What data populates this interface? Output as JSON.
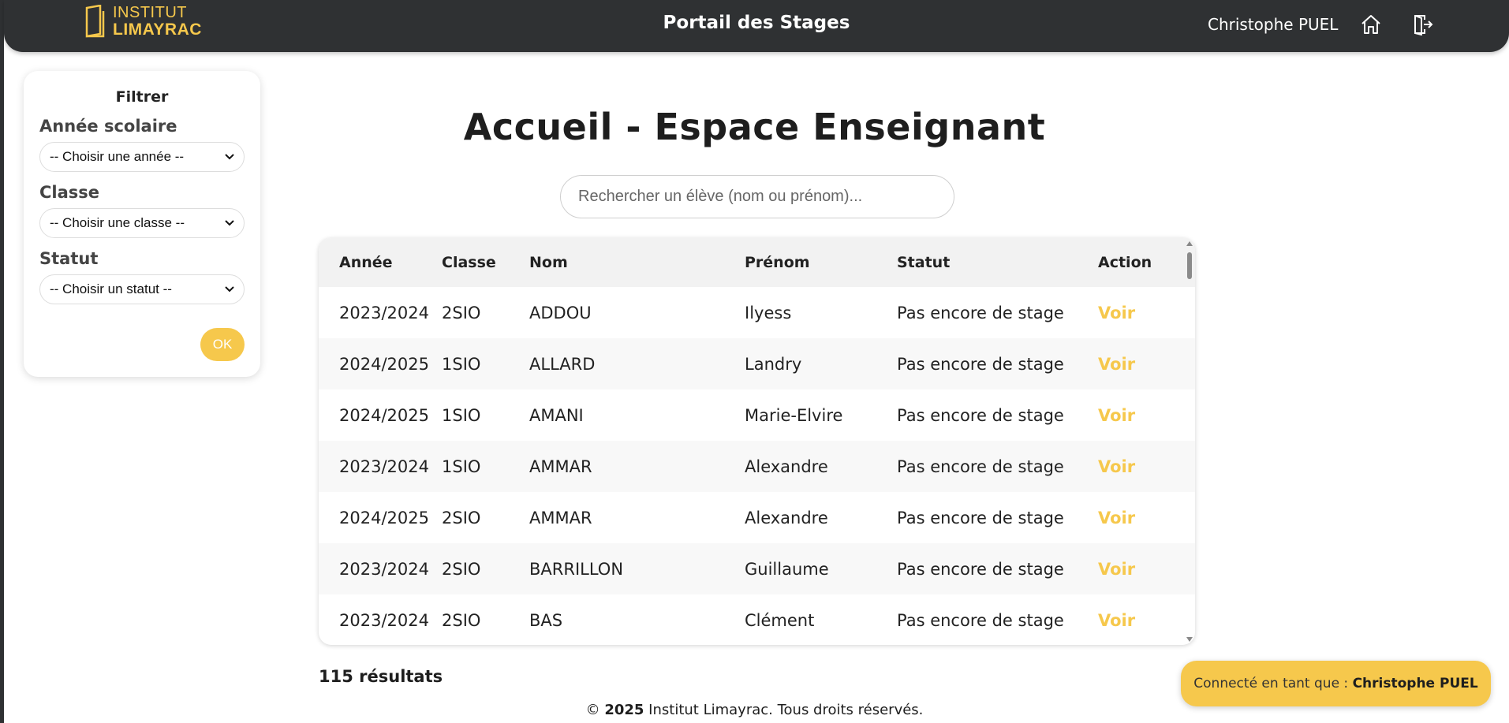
{
  "header": {
    "logo_line1": "INSTITUT",
    "logo_line2": "LIMAYRAC",
    "title": "Portail des Stages",
    "user": "Christophe PUEL",
    "home_icon": "home-icon",
    "logout_icon": "logout-icon"
  },
  "filters": {
    "title": "Filtrer",
    "year_label": "Année scolaire",
    "year_value": "-- Choisir une année --",
    "class_label": "Classe",
    "class_value": "-- Choisir une classe --",
    "status_label": "Statut",
    "status_value": "-- Choisir un statut --",
    "ok_label": "OK"
  },
  "main": {
    "title": "Accueil - Espace Enseignant",
    "search_placeholder": "Rechercher un élève (nom ou prénom)..."
  },
  "table": {
    "headers": [
      "Année",
      "Classe",
      "Nom",
      "Prénom",
      "Statut",
      "Action"
    ],
    "rows": [
      [
        "2023/2024",
        "2SIO",
        "ADDOU",
        "Ilyess",
        "Pas encore de stage",
        "Voir"
      ],
      [
        "2024/2025",
        "1SIO",
        "ALLARD",
        "Landry",
        "Pas encore de stage",
        "Voir"
      ],
      [
        "2024/2025",
        "1SIO",
        "AMANI",
        "Marie-Elvire",
        "Pas encore de stage",
        "Voir"
      ],
      [
        "2023/2024",
        "1SIO",
        "AMMAR",
        "Alexandre",
        "Pas encore de stage",
        "Voir"
      ],
      [
        "2024/2025",
        "2SIO",
        "AMMAR",
        "Alexandre",
        "Pas encore de stage",
        "Voir"
      ],
      [
        "2023/2024",
        "2SIO",
        "BARRILLON",
        "Guillaume",
        "Pas encore de stage",
        "Voir"
      ],
      [
        "2023/2024",
        "2SIO",
        "BAS",
        "Clément",
        "Pas encore de stage",
        "Voir"
      ]
    ]
  },
  "results_count": "115 résultats",
  "footer": {
    "copyright": "©",
    "year": "2025",
    "text": "Institut Limayrac. Tous droits réservés."
  },
  "toast": {
    "prefix": "Connecté en tant que :",
    "user": "Christophe PUEL"
  },
  "colors": {
    "accent": "#f6c84c",
    "topbar": "#2f3133"
  }
}
